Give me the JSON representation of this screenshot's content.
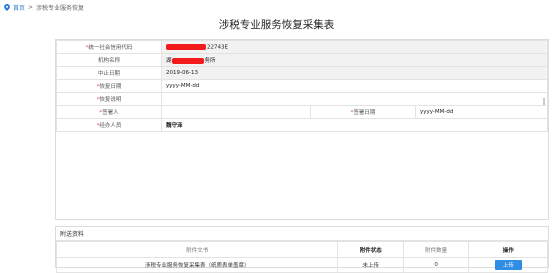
{
  "breadcrumb": {
    "home": "首页",
    "sep": ">",
    "current": "涉税专业服务恢复"
  },
  "page_title": "涉税专业服务恢复采集表",
  "form": {
    "credit_code": {
      "label": "统一社会信用代码",
      "value_suffix": "22743E"
    },
    "org_name": {
      "label": "机构名称",
      "value_prefix": "湖",
      "value_suffix": "务所"
    },
    "suspend_date": {
      "label": "中止日期",
      "value": "2019-06-13"
    },
    "restore_date": {
      "label": "恢复日期",
      "placeholder": "yyyy-MM-dd"
    },
    "restore_desc": {
      "label": "恢复说明"
    },
    "signer": {
      "label": "签署人"
    },
    "sign_date": {
      "label": "签署日期",
      "placeholder": "yyyy-MM-dd"
    },
    "handler": {
      "label": "经办人员",
      "value": "魏守泽"
    }
  },
  "attachment": {
    "heading": "附送资料",
    "columns": [
      "附件文书",
      "附件状态",
      "附件数量",
      "操作"
    ],
    "rows": [
      {
        "doc": "涉税专业服务恢复采集表（纸质表单盖章）",
        "status": "未上传",
        "count": "0",
        "action": "上传"
      }
    ]
  },
  "colors": {
    "accent": "#2f8de4",
    "required": "#e34b4b",
    "redaction": "#f21a1a"
  },
  "icons": {
    "breadcrumb": "location-pin-icon"
  }
}
